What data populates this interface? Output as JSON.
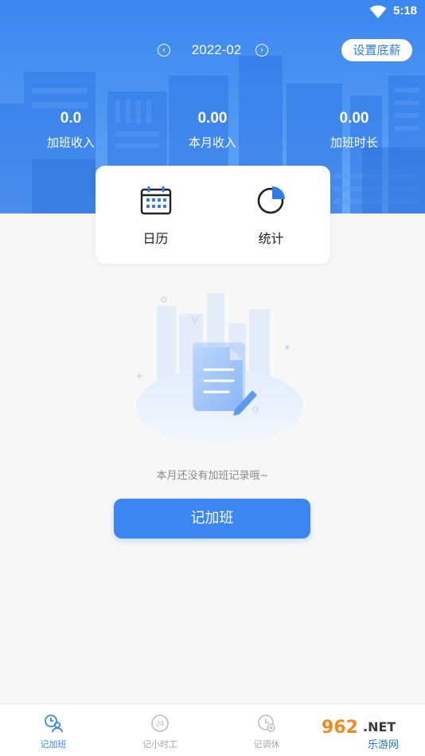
{
  "status_bar": {
    "time": "5:18",
    "icons": [
      "wifi-icon"
    ]
  },
  "header": {
    "month": "2022-02",
    "prev_icon": "chevron-left-circle-icon",
    "next_icon": "chevron-right-circle-icon",
    "set_salary_label": "设置底薪"
  },
  "stats": [
    {
      "value": "0.0",
      "label": "加班收入"
    },
    {
      "value": "0.00",
      "label": "本月收入"
    },
    {
      "value": "0.00",
      "label": "加班时长"
    }
  ],
  "quick_actions": [
    {
      "label": "日历",
      "icon": "calendar-icon"
    },
    {
      "label": "统计",
      "icon": "pie-chart-icon"
    }
  ],
  "empty_state": {
    "message": "本月还没有加班记录哦~",
    "illustration": "empty-document-icon"
  },
  "primary_action": {
    "label": "记加班"
  },
  "bottom_nav": [
    {
      "label": "记加班",
      "icon": "overtime-icon",
      "active": true
    },
    {
      "label": "记小时工",
      "icon": "hourly-24-icon",
      "active": false
    },
    {
      "label": "记调休",
      "icon": "clock-plus-icon",
      "active": false
    },
    {
      "label": "",
      "icon": "more-icon",
      "active": false
    }
  ],
  "watermark": {
    "line1": "962.NET",
    "line2": "乐游网"
  },
  "colors": {
    "primary": "#3b86f0",
    "accent_text": "#2e7ce9",
    "background": "#f7f7f8"
  }
}
